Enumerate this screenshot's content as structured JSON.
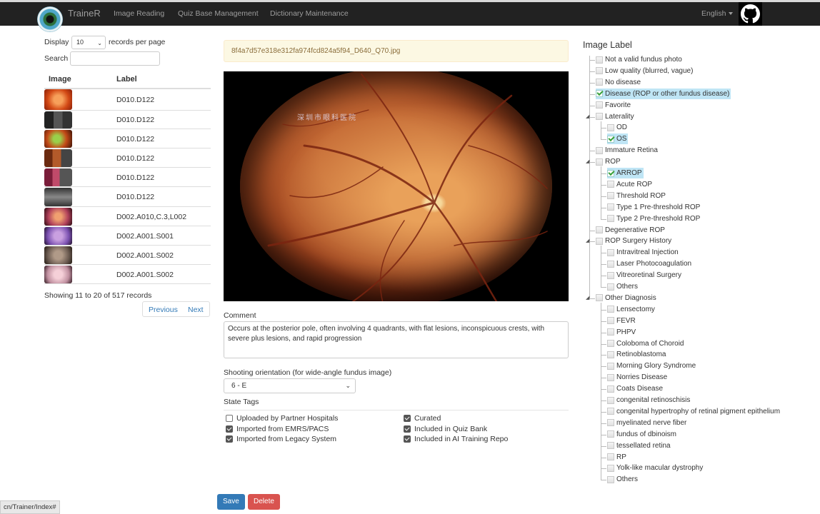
{
  "nav": {
    "brand": "TraineR",
    "links": [
      "Image Reading",
      "Quiz Base Management",
      "Dictionary Maintenance"
    ],
    "language": "English",
    "github_icon": "github-icon"
  },
  "table_controls": {
    "display_label": "Display",
    "page_size": "10",
    "per_page_label": "records per page",
    "search_label": "Search",
    "search_value": ""
  },
  "table": {
    "headers": [
      "Image",
      "Label"
    ],
    "rows": [
      {
        "label": "D010.D122"
      },
      {
        "label": "D010.D122"
      },
      {
        "label": "D010.D122"
      },
      {
        "label": "D010.D122"
      },
      {
        "label": "D010.D122"
      },
      {
        "label": "D010.D122"
      },
      {
        "label": "D002.A010,C.3,L002"
      },
      {
        "label": "D002.A001.S001"
      },
      {
        "label": "D002.A001.S002"
      },
      {
        "label": "D002.A001.S002"
      }
    ],
    "showing": "Showing 11 to 20 of 517 records",
    "previous": "Previous",
    "next": "Next"
  },
  "viewer": {
    "filename": "8f4a7d57e318e312fa974fcd824a5f94_D640_Q70.jpg",
    "watermark_text": "深圳市眼科医院",
    "comment_label": "Comment",
    "comment": "Occurs at the posterior pole, often involving 4 quadrants, with flat lesions, inconspicuous crests, with severe plus lesions, and rapid progression",
    "orientation_label": "Shooting orientation (for wide-angle fundus image)",
    "orientation_value": "6 - E",
    "state_tags_label": "State Tags",
    "state_tags": [
      {
        "label": "Uploaded by Partner Hospitals",
        "checked": false
      },
      {
        "label": "Curated",
        "checked": true
      },
      {
        "label": "Imported from EMRS/PACS",
        "checked": true
      },
      {
        "label": "Included in Quiz Bank",
        "checked": true
      },
      {
        "label": "Imported from Legacy System",
        "checked": true
      },
      {
        "label": "Included in AI Training Repo",
        "checked": true
      }
    ],
    "save": "Save",
    "delete": "Delete"
  },
  "status_url": "cn/Trainer/Index#",
  "tree": {
    "title": "Image Label",
    "nodes": [
      {
        "label": "Not a valid fundus photo",
        "checked": false
      },
      {
        "label": "Low quality (blurred, vague)",
        "checked": false
      },
      {
        "label": "No disease",
        "checked": false
      },
      {
        "label": "Disease (ROP or other fundus disease)",
        "checked": true
      },
      {
        "label": "Favorite",
        "checked": false
      },
      {
        "label": "Laterality",
        "checked": false
      },
      {
        "label": "OD",
        "checked": false
      },
      {
        "label": "OS",
        "checked": true
      },
      {
        "label": "Immature Retina",
        "checked": false
      },
      {
        "label": "ROP",
        "checked": false
      },
      {
        "label": "ARROP",
        "checked": true
      },
      {
        "label": "Acute ROP",
        "checked": false
      },
      {
        "label": "Threshold ROP",
        "checked": false
      },
      {
        "label": "Type 1 Pre-threshold ROP",
        "checked": false
      },
      {
        "label": "Type 2 Pre-threshold ROP",
        "checked": false
      },
      {
        "label": "Degenerative ROP",
        "checked": false
      },
      {
        "label": "ROP Surgery History",
        "checked": false
      },
      {
        "label": "Intravitreal Injection",
        "checked": false
      },
      {
        "label": "Laser Photocoagulation",
        "checked": false
      },
      {
        "label": "Vitreoretinal Surgery",
        "checked": false
      },
      {
        "label": "Others",
        "checked": false
      },
      {
        "label": "Other Diagnosis",
        "checked": false
      },
      {
        "label": "Lensectomy",
        "checked": false
      },
      {
        "label": "FEVR",
        "checked": false
      },
      {
        "label": "PHPV",
        "checked": false
      },
      {
        "label": "Coloboma of Choroid",
        "checked": false
      },
      {
        "label": "Retinoblastoma",
        "checked": false
      },
      {
        "label": "Morning Glory Syndrome",
        "checked": false
      },
      {
        "label": "Norries Disease",
        "checked": false
      },
      {
        "label": "Coats Disease",
        "checked": false
      },
      {
        "label": "congenital retinoschisis",
        "checked": false
      },
      {
        "label": "congenital hypertrophy of retinal pigment epithelium",
        "checked": false
      },
      {
        "label": "myelinated nerve fiber",
        "checked": false
      },
      {
        "label": "fundus of dbinoism",
        "checked": false
      },
      {
        "label": "tessellated retina",
        "checked": false
      },
      {
        "label": "RP",
        "checked": false
      },
      {
        "label": "Yolk-like macular dystrophy",
        "checked": false
      },
      {
        "label": "Others",
        "checked": false
      }
    ]
  },
  "colors": {
    "navbar": "#222222",
    "link": "#337ab7",
    "save_button": "#337ab7",
    "delete_button": "#d9534f",
    "selected_node": "#bfe5f5",
    "file_banner": "#fcf8e3"
  }
}
